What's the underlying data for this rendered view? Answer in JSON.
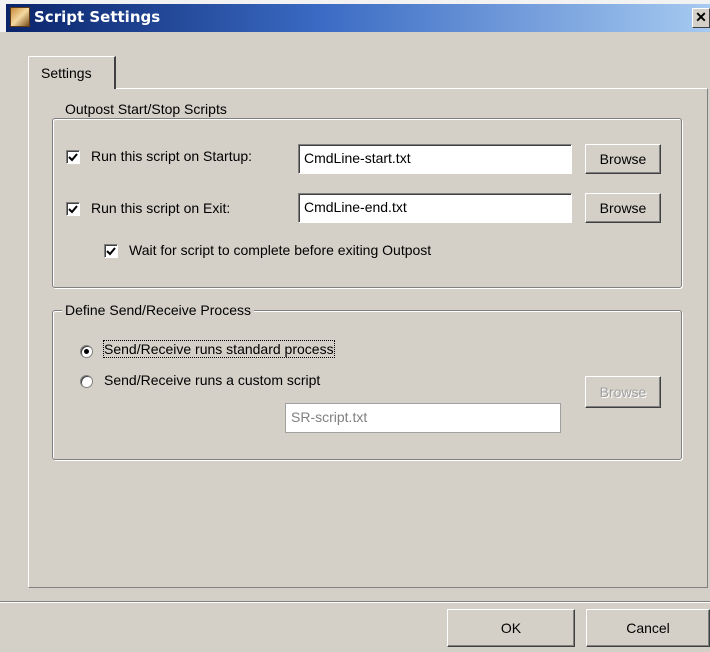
{
  "window": {
    "title": "Script Settings",
    "close_glyph": "✕"
  },
  "tabs": [
    {
      "label": "Settings"
    }
  ],
  "startstop_group": {
    "label": "Outpost Start/Stop Scripts",
    "startup": {
      "label": "Run this script on Startup:",
      "checked": true,
      "value": "CmdLine-start.txt",
      "browse_label": "Browse"
    },
    "exit": {
      "label": "Run this script on Exit:",
      "checked": true,
      "value": "CmdLine-end.txt",
      "browse_label": "Browse"
    },
    "wait": {
      "label": "Wait for script to complete before exiting Outpost",
      "checked": true
    }
  },
  "sendreceive_group": {
    "label": "Define Send/Receive Process",
    "standard": {
      "label": "Send/Receive runs standard process",
      "selected": true
    },
    "custom": {
      "label": "Send/Receive runs a custom script",
      "selected": false
    },
    "script_value": "SR-script.txt",
    "browse_label": "Browse"
  },
  "footer": {
    "ok_label": "OK",
    "cancel_label": "Cancel"
  },
  "icons": {
    "app": "script-app-icon",
    "close": "close-icon",
    "check": "checkmark-icon"
  }
}
